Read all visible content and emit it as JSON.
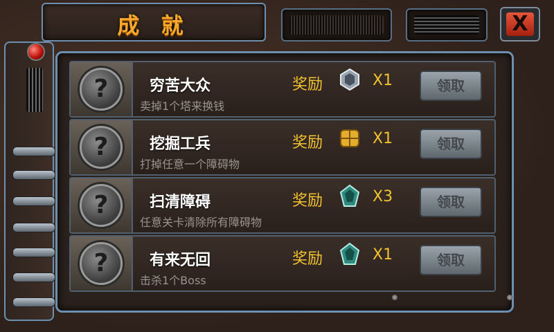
{
  "header": {
    "title": "成 就",
    "close_label": "X"
  },
  "achievements": [
    {
      "name": "穷苦大众",
      "description": "卖掉1个塔来换钱",
      "reward_label": "奖励",
      "reward_icon": "gray-crystal-icon",
      "quantity": "X1",
      "claim_label": "领取"
    },
    {
      "name": "挖掘工兵",
      "description": "打掉任意一个障碍物",
      "reward_label": "奖励",
      "reward_icon": "gold-block-icon",
      "quantity": "X1",
      "claim_label": "领取"
    },
    {
      "name": "扫清障碍",
      "description": "任意关卡清除所有障碍物",
      "reward_label": "奖励",
      "reward_icon": "teal-crystal-icon",
      "quantity": "X3",
      "claim_label": "领取"
    },
    {
      "name": "有来无回",
      "description": "击杀1个Boss",
      "reward_label": "奖励",
      "reward_icon": "teal-crystal-icon",
      "quantity": "X1",
      "claim_label": "领取"
    }
  ],
  "colors": {
    "title": "#f7a72a",
    "reward_text": "#f2c230",
    "frame_border": "#6d8fb0",
    "close_button": "#d23a20"
  }
}
